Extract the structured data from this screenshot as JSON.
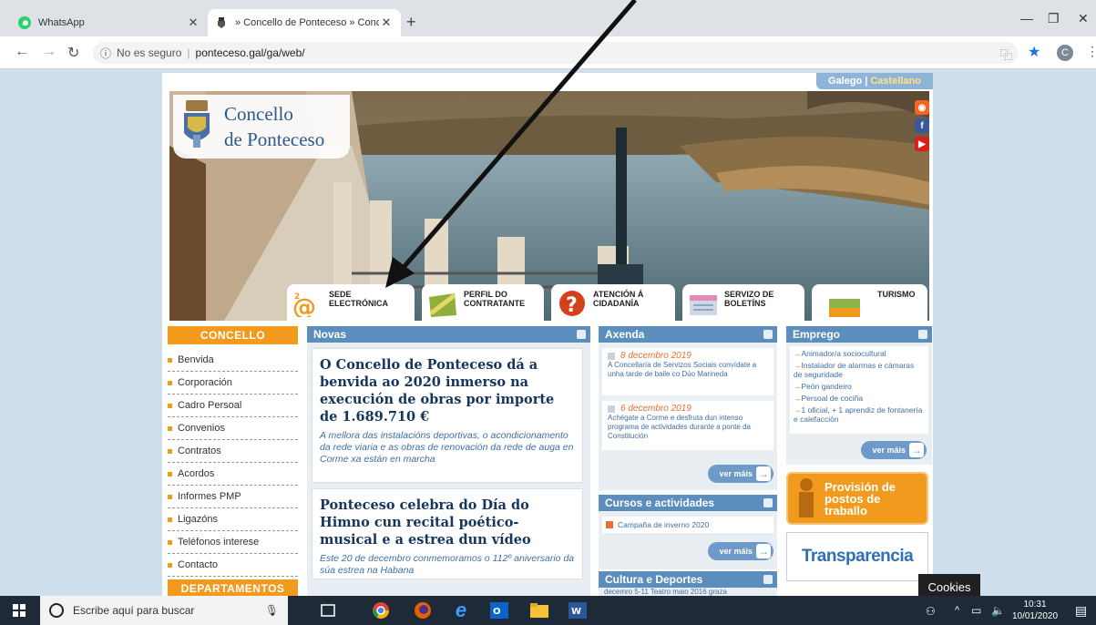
{
  "browser": {
    "tabs": [
      {
        "title": "WhatsApp"
      },
      {
        "title": "» Concello de Ponteceso » Conce"
      }
    ],
    "new_tab": "+",
    "url_prefix": "No es seguro",
    "url": "ponteceso.gal/ga/web/",
    "profile_initial": "C"
  },
  "site": {
    "lang": {
      "galego": "Galego",
      "separator": "|",
      "castellano": "Castellano"
    },
    "logo_line1": "Concello",
    "logo_line2": "de Ponteceso",
    "quicklinks": [
      {
        "l1": "SEDE",
        "l2": "ELECTRÓNICA"
      },
      {
        "l1": "PERFIL DO",
        "l2": "CONTRATANTE"
      },
      {
        "l1": "ATENCIÓN Á",
        "l2": "CIDADANÍA"
      },
      {
        "l1": "SERVIZO DE",
        "l2": "BOLETÍNS"
      },
      {
        "l1": "TURISMO",
        "l2": ""
      }
    ],
    "sidebar": {
      "heading": "CONCELLO",
      "items": [
        "Benvida",
        "Corporación",
        "Cadro Persoal",
        "Convenios",
        "Contratos",
        "Acordos",
        "Informes PMP",
        "Ligazóns",
        "Teléfonos interese",
        "Contacto"
      ],
      "heading2": "DEPARTAMENTOS"
    },
    "novas": {
      "heading": "Novas",
      "items": [
        {
          "title": "O Concello de Ponteceso dá a benvida ao 2020 inmerso na execución de obras por importe de 1.689.710 €",
          "sub": "A mellora das instalacións deportivas, o acondicionamento da rede viaria e as obras de renovación da rede de auga en Corme xa están en marcha"
        },
        {
          "title": "Ponteceso celebra do Día do Himno cun recital poético-musical e a estrea dun vídeo",
          "sub": "Este 20 de decembro conmemoramos o 112º aniversario da súa estrea na Habana"
        }
      ]
    },
    "axenda": {
      "heading": "Axenda",
      "events": [
        {
          "date": "8 decembro 2019",
          "text": "A Concellaría de Servizos Sociais convídate a unha tarde de baile co Dúo Marineda"
        },
        {
          "date": "6 decembro 2019",
          "text": "Achégate a Corme e desfruta dun intenso programa de actividades durante a ponte da Constitución"
        }
      ],
      "ver_mais": "ver máis"
    },
    "cursos": {
      "heading": "Cursos e actividades",
      "items": [
        "Campaña de inverno 2020"
      ],
      "ver_mais": "ver máis"
    },
    "cultura": {
      "heading": "Cultura e Deportes",
      "peek": "decemro 5-11 Teatro maio 2016 graza"
    },
    "emprego": {
      "heading": "Emprego",
      "items": [
        "Animador/a sociocultural",
        "Instalador de alarmas e cámaras de seguridade",
        "Peón gandeiro",
        "Persoal de cociña",
        "1 oficial, + 1 aprendiz de fontanería e calefacción"
      ],
      "ver_mais": "ver máis"
    },
    "provision": {
      "l1": "Provisión de",
      "l2": "postos de",
      "l3": "traballo"
    },
    "transparencia": "Transparencia"
  },
  "cookies_tooltip": "Cookies",
  "taskbar": {
    "search_placeholder": "Escribe aquí para buscar",
    "time": "10:31",
    "date": "10/01/2020"
  },
  "colors": {
    "orange": "#f19a1d",
    "panel_blue": "#5b8dbd",
    "news_title": "#15355d",
    "link_blue": "#3f6fa3"
  }
}
